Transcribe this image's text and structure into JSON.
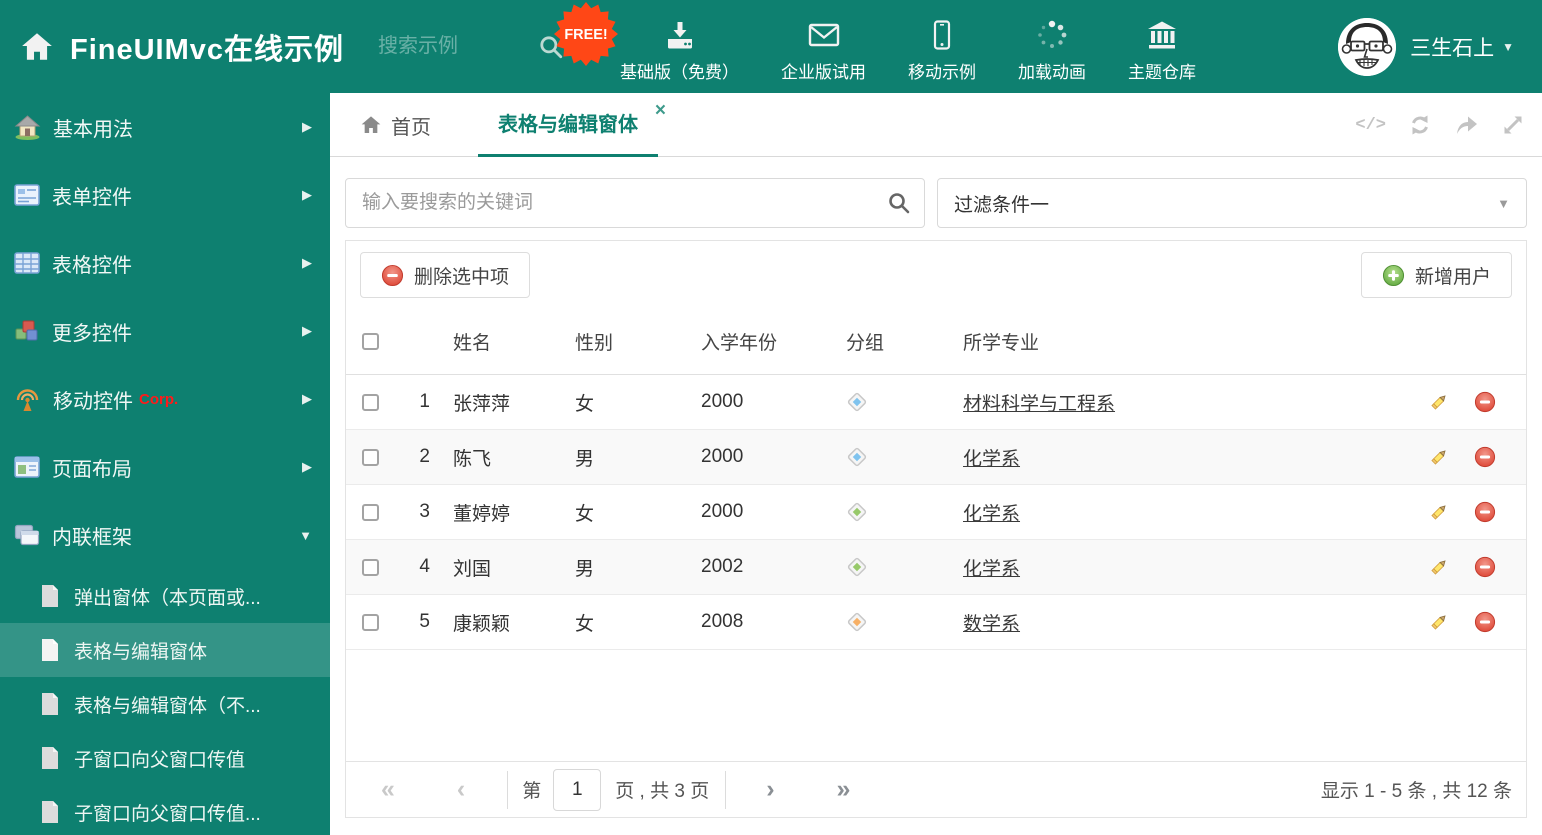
{
  "colors": {
    "accent": "#0e8070",
    "free_badge": "#ff4716"
  },
  "header": {
    "title": "FineUIMvc在线示例",
    "search_placeholder": "搜索示例",
    "free_badge": "FREE!",
    "actions": [
      {
        "label": "基础版（免费）",
        "icon": "download-icon"
      },
      {
        "label": "企业版试用",
        "icon": "envelope-icon"
      },
      {
        "label": "移动示例",
        "icon": "mobile-icon"
      },
      {
        "label": "加载动画",
        "icon": "spinner-icon"
      },
      {
        "label": "主题仓库",
        "icon": "bank-icon"
      }
    ],
    "user_name": "三生石上"
  },
  "sidebar": {
    "items": [
      {
        "label": "基本用法"
      },
      {
        "label": "表单控件"
      },
      {
        "label": "表格控件"
      },
      {
        "label": "更多控件"
      },
      {
        "label": "移动控件",
        "badge": "Corp."
      },
      {
        "label": "页面布局"
      },
      {
        "label": "内联框架"
      }
    ],
    "subitems": [
      {
        "label": "弹出窗体（本页面或..."
      },
      {
        "label": "表格与编辑窗体",
        "selected": true
      },
      {
        "label": "表格与编辑窗体（不..."
      },
      {
        "label": "子窗口向父窗口传值"
      },
      {
        "label": "子窗口向父窗口传值..."
      }
    ]
  },
  "tabs": {
    "home_label": "首页",
    "active_label": "表格与编辑窗体"
  },
  "filters": {
    "search_placeholder": "输入要搜索的关键词",
    "filter_value": "过滤条件一"
  },
  "toolbar": {
    "delete_label": "删除选中项",
    "add_label": "新增用户"
  },
  "table": {
    "columns": [
      "姓名",
      "性别",
      "入学年份",
      "分组",
      "所学专业"
    ],
    "rows": [
      {
        "num": "1",
        "name": "张萍萍",
        "gender": "女",
        "year": "2000",
        "tag_color": "#7fc3ee",
        "major": "材料科学与工程系"
      },
      {
        "num": "2",
        "name": "陈飞",
        "gender": "男",
        "year": "2000",
        "tag_color": "#7fc3ee",
        "major": "化学系"
      },
      {
        "num": "3",
        "name": "董婷婷",
        "gender": "女",
        "year": "2000",
        "tag_color": "#97c96a",
        "major": "化学系"
      },
      {
        "num": "4",
        "name": "刘国",
        "gender": "男",
        "year": "2002",
        "tag_color": "#97c96a",
        "major": "化学系"
      },
      {
        "num": "5",
        "name": "康颖颖",
        "gender": "女",
        "year": "2008",
        "tag_color": "#f7b066",
        "major": "数学系"
      }
    ]
  },
  "pagination": {
    "page_prefix": "第",
    "page_value": "1",
    "page_suffix": "页 , 共 3 页",
    "summary": "显示 1 - 5 条 , 共 12 条"
  }
}
